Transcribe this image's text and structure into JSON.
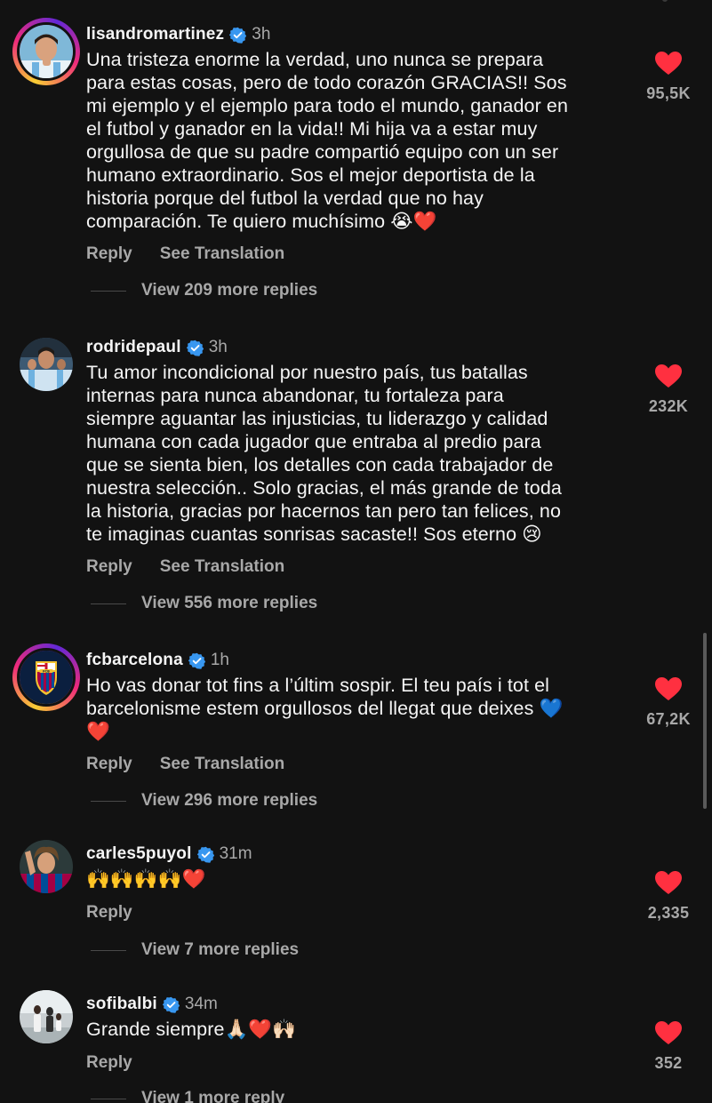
{
  "colors": {
    "background": "#121212",
    "text_primary": "#f5f5f5",
    "text_secondary": "#a8a8a8",
    "like_heart": "#ff3040",
    "verified_badge": "#3897f0"
  },
  "comments": [
    {
      "username": "lisandromartinez",
      "verified": true,
      "time": "3h",
      "text": "Una tristeza enorme la verdad, uno nunca se prepara\npara estas cosas, pero de todo corazón GRACIAS!! Sos\nmi ejemplo y el ejemplo para todo el mundo, ganador en\nel futbol y ganador en la vida!! Mi hija va a estar muy\norgullosa de que su padre compartió equipo con un ser\nhumano extraordinario. Sos el mejor deportista de la\nhistoria porque del futbol la verdad que no hay\ncomparación. Te quiero muchísimo 😭❤️",
      "reply_label": "Reply",
      "translate_label": "See Translation",
      "more_replies": "View 209 more replies",
      "like_icon": "heart-filled-icon",
      "likes": "95,5K"
    },
    {
      "username": "rodridepaul",
      "verified": true,
      "time": "3h",
      "text": "Tu amor incondicional por nuestro país, tus batallas\ninternas para nunca abandonar, tu fortaleza para\nsiempre aguantar las injusticias, tu liderazgo y calidad\nhumana con cada jugador que entraba al predio para\nque se sienta bien, los detalles con cada trabajador de\nnuestra selección.. Solo gracias, el más grande de toda\nla historia, gracias por hacernos tan pero tan felices, no\nte imaginas cuantas sonrisas sacaste!! Sos eterno 😢",
      "reply_label": "Reply",
      "translate_label": "See Translation",
      "more_replies": "View 556 more replies",
      "like_icon": "heart-filled-icon",
      "likes": "232K"
    },
    {
      "username": "fcbarcelona",
      "verified": true,
      "time": "1h",
      "text": "Ho vas donar tot fins a l’últim sospir. El teu país i tot el\nbarcelonisme estem orgullosos del llegat que deixes 💙\n❤️",
      "reply_label": "Reply",
      "translate_label": "See Translation",
      "more_replies": "View 296 more replies",
      "like_icon": "heart-filled-icon",
      "likes": "67,2K",
      "avatar_label": "FCB"
    },
    {
      "username": "carles5puyol",
      "verified": true,
      "time": "31m",
      "text": "🙌🙌🙌🙌❤️",
      "reply_label": "Reply",
      "more_replies": "View 7 more replies",
      "like_icon": "heart-filled-icon",
      "likes": "2,335"
    },
    {
      "username": "sofibalbi",
      "verified": true,
      "time": "34m",
      "text": "Grande siempre🙏🏻❤️🙌🏻",
      "reply_label": "Reply",
      "more_replies": "View 1 more reply",
      "like_icon": "heart-filled-icon",
      "likes": "352"
    }
  ]
}
